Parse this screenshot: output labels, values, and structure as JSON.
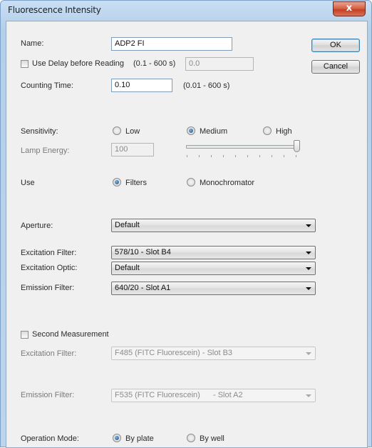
{
  "window": {
    "title": "Fluorescence Intensity",
    "close_label": "x"
  },
  "buttons": {
    "ok": "OK",
    "cancel": "Cancel"
  },
  "name": {
    "label": "Name:",
    "value": "ADP2 FI"
  },
  "delay": {
    "label": "Use Delay before Reading",
    "range": "(0.1 - 600 s)",
    "value": "0.0",
    "checked": false
  },
  "counting": {
    "label": "Counting Time:",
    "value": "0.10",
    "range": "(0.01 - 600 s)"
  },
  "sensitivity": {
    "label": "Sensitivity:",
    "options": [
      "Low",
      "Medium",
      "High"
    ],
    "selected": "Medium"
  },
  "lamp": {
    "label": "Lamp Energy:",
    "value": "100",
    "slider_level_percent": 100
  },
  "use": {
    "label": "Use",
    "options": [
      "Filters",
      "Monochromator"
    ],
    "selected": "Filters"
  },
  "aperture": {
    "label": "Aperture:",
    "value": "Default"
  },
  "excitation_filter": {
    "label": "Excitation Filter:",
    "value": "578/10 - Slot B4"
  },
  "excitation_optic": {
    "label": "Excitation Optic:",
    "value": "Default"
  },
  "emission_filter": {
    "label": "Emission Filter:",
    "value": "640/20 - Slot A1"
  },
  "second": {
    "label": "Second Measurement",
    "checked": false,
    "excitation_label": "Excitation Filter:",
    "excitation_value": "F485 (FITC Fluorescein) - Slot B3",
    "emission_label": "Emission Filter:",
    "emission_value": "F535 (FITC Fluorescein)",
    "emission_slot": "- Slot A2"
  },
  "operation": {
    "label": "Operation Mode:",
    "options": [
      "By plate",
      "By well"
    ],
    "selected": "By plate"
  },
  "colors": {
    "frame": "#bcd5ec",
    "client": "#f0f0f0",
    "close_button": "#c33e22",
    "radio_dot": "#1f4f8f"
  }
}
